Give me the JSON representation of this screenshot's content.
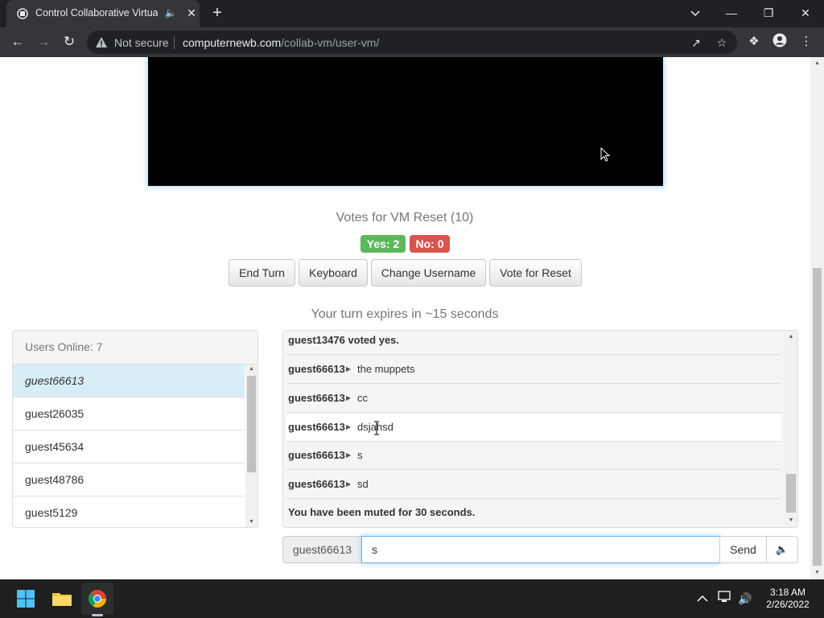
{
  "browser": {
    "tab_title": "Control Collaborative Virtual",
    "security_label": "Not secure",
    "url_host": "computernewb.com",
    "url_path": "/collab-vm/user-vm/"
  },
  "vm": {
    "votes_title": "Votes for VM Reset (10)",
    "yes_label": "Yes: 2",
    "no_label": "No: 0",
    "buttons": {
      "end_turn": "End Turn",
      "keyboard": "Keyboard",
      "change_username": "Change Username",
      "vote_reset": "Vote for Reset"
    },
    "turn_message": "Your turn expires in ~15 seconds"
  },
  "users": {
    "header": "Users Online: 7",
    "list": [
      "guest66613",
      "guest26035",
      "guest45634",
      "guest48786",
      "guest5129"
    ]
  },
  "chat": {
    "messages": [
      {
        "system": "guest13476 voted yes."
      },
      {
        "user": "guest66613",
        "text": "the muppets"
      },
      {
        "user": "guest66613",
        "text": "cc"
      },
      {
        "user": "guest66613",
        "text": "dsjahsd"
      },
      {
        "user": "guest66613",
        "text": "s"
      },
      {
        "user": "guest66613",
        "text": "sd"
      },
      {
        "system": "You have been muted for 30 seconds."
      }
    ],
    "username_addon": "guest66613",
    "input_value": "s",
    "send_label": "Send"
  },
  "taskbar": {
    "time": "3:18 AM",
    "date": "2/26/2022"
  },
  "colors": {
    "yes": "#5cb85c",
    "no": "#d9534f",
    "active_user": "#d9edf7",
    "input_focus": "#66afe9"
  }
}
